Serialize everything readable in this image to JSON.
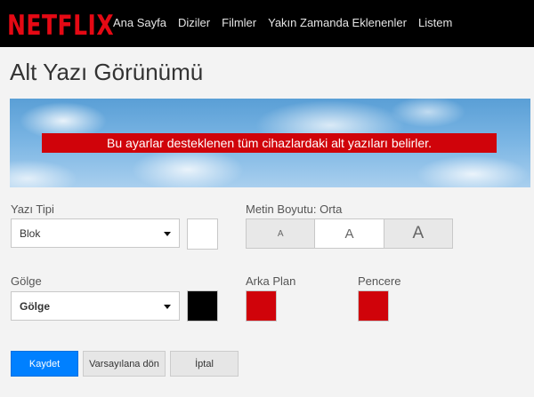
{
  "nav": {
    "logo": "NETFLIX",
    "items": [
      "Ana Sayfa",
      "Diziler",
      "Filmler",
      "Yakın Zamanda Eklenenler",
      "Listem"
    ]
  },
  "page": {
    "title": "Alt Yazı Görünümü"
  },
  "preview": {
    "caption": "Bu ayarlar desteklenen tüm cihazlardaki alt yazıları belirler."
  },
  "font": {
    "label": "Yazı Tipi",
    "value": "Blok",
    "color": "#ffffff"
  },
  "text_size": {
    "label": "Metin Boyutu: Orta",
    "options": [
      "A",
      "A",
      "A"
    ],
    "selected": "Orta"
  },
  "shadow": {
    "label": "Gölge",
    "value": "Gölge",
    "color": "#000000"
  },
  "background": {
    "label": "Arka Plan",
    "color": "#d0030a"
  },
  "window": {
    "label": "Pencere",
    "color": "#d0030a"
  },
  "actions": {
    "save": "Kaydet",
    "reset": "Varsayılana dön",
    "cancel": "İptal"
  }
}
